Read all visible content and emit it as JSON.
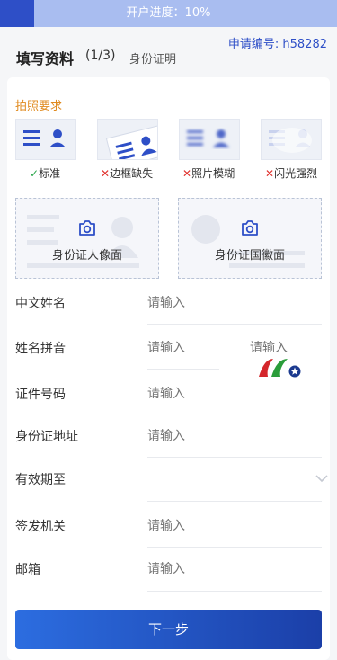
{
  "progress": {
    "label": "开户进度：10%",
    "fraction": 0.1
  },
  "application_no": "申请编号: h58282",
  "header": {
    "title": "填写资料",
    "step": "(1/3)",
    "subtitle": "身份证明"
  },
  "photo_requirements": {
    "title": "拍照要求",
    "items": [
      {
        "mark": "✓",
        "label": "标准",
        "status": "ok"
      },
      {
        "mark": "✕",
        "label": "边框缺失",
        "status": "bad"
      },
      {
        "mark": "✕",
        "label": "照片模糊",
        "status": "bad"
      },
      {
        "mark": "✕",
        "label": "闪光强烈",
        "status": "bad"
      }
    ]
  },
  "uploads": {
    "front_label": "身份证人像面",
    "back_label": "身份证国徽面"
  },
  "form": {
    "name_cn": {
      "label": "中文姓名",
      "placeholder": "请输入"
    },
    "pinyin": {
      "label": "姓名拼音",
      "placeholder_last": "请输入",
      "placeholder_first": "请输入"
    },
    "id_no": {
      "label": "证件号码",
      "placeholder": "请输入"
    },
    "address": {
      "label": "身份证地址",
      "placeholder": "请输入"
    },
    "expiry": {
      "label": "有效期至",
      "value": ""
    },
    "issuer": {
      "label": "签发机关",
      "placeholder": "请输入"
    },
    "email": {
      "label": "邮箱",
      "placeholder": "请输入"
    }
  },
  "next_button": "下一步",
  "colors": {
    "accent": "#2e4fc7",
    "warning": "#e08a1e",
    "ok": "#2fa84f",
    "error": "#e0312d"
  }
}
